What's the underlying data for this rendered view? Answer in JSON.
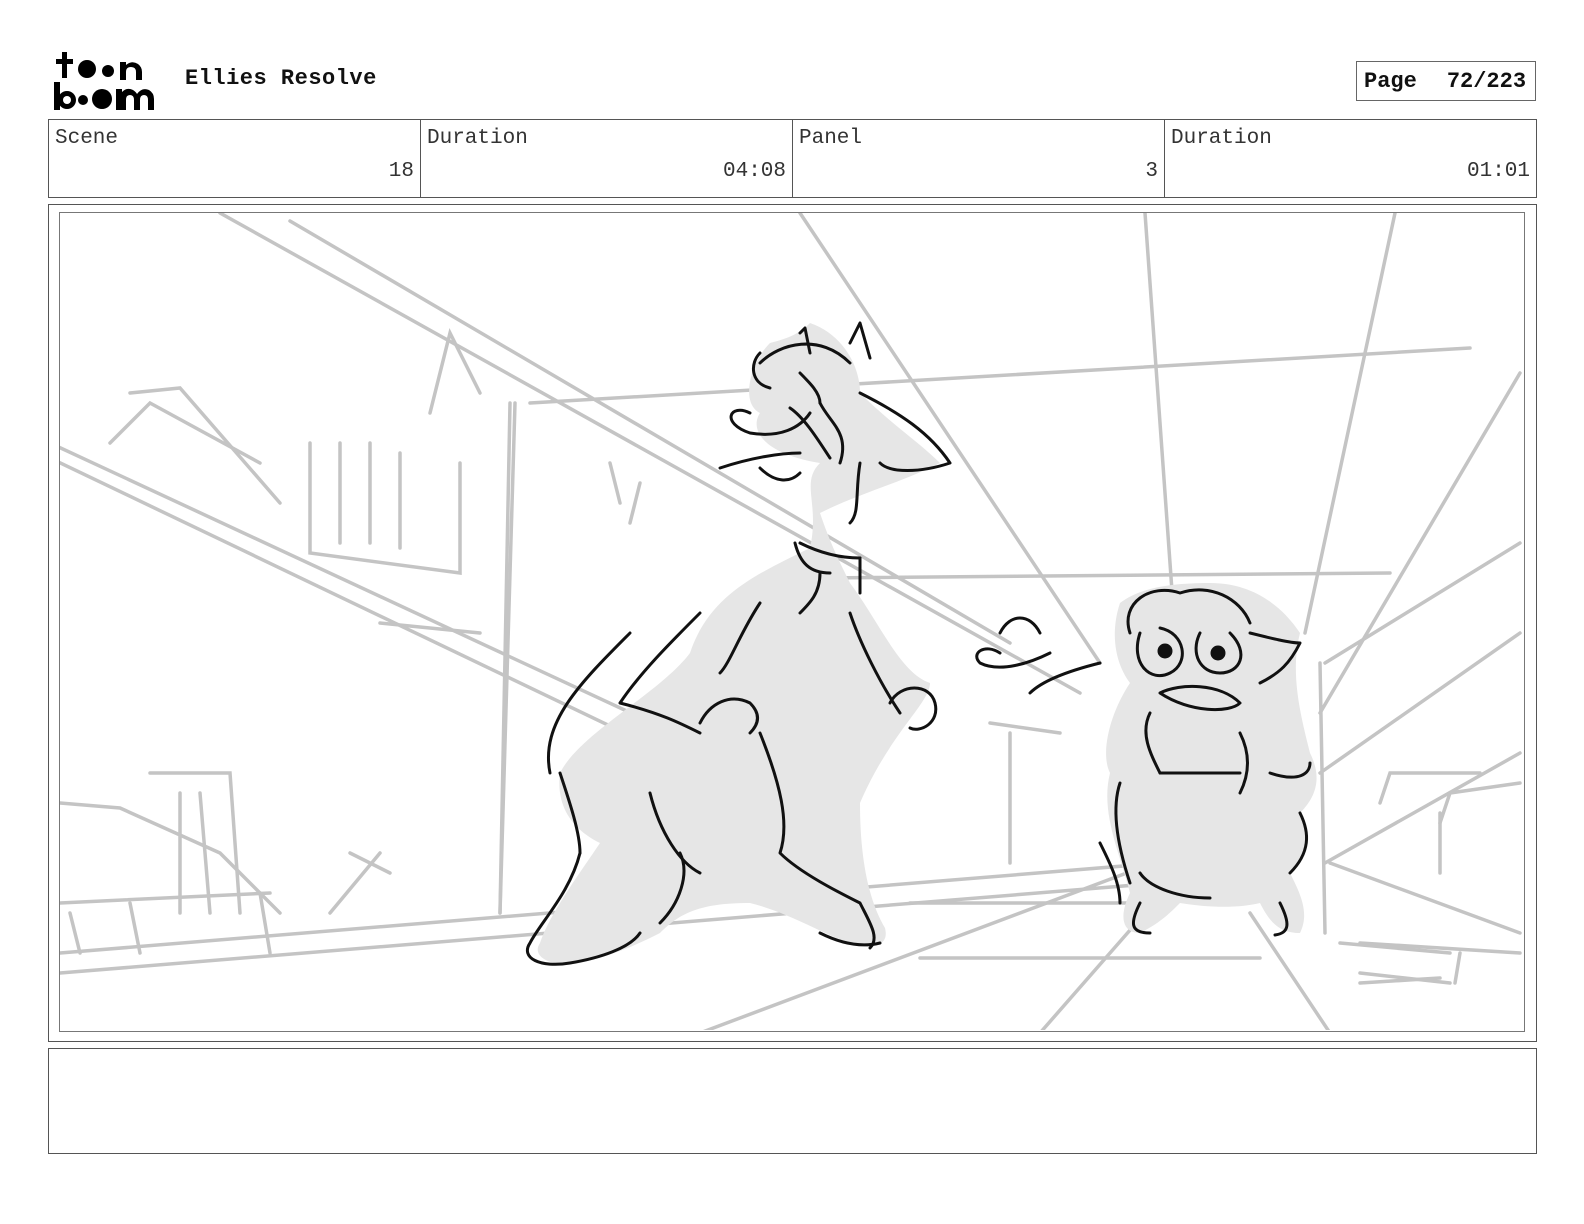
{
  "header": {
    "logo_text_line1": "toon",
    "logo_text_line2": "boom",
    "project_title": "Ellies Resolve",
    "page_label": "Page",
    "page_number": "72/223"
  },
  "info": {
    "scene_label": "Scene",
    "scene_value": "18",
    "scene_duration_label": "Duration",
    "scene_duration_value": "04:08",
    "panel_label": "Panel",
    "panel_value": "3",
    "panel_duration_label": "Duration",
    "panel_duration_value": "01:01"
  },
  "notes": {
    "text": ""
  },
  "colors": {
    "frame": "#555555",
    "sketch_light": "#c4c4c4",
    "sketch_dark": "#111111",
    "fill": "#e6e6e6"
  }
}
